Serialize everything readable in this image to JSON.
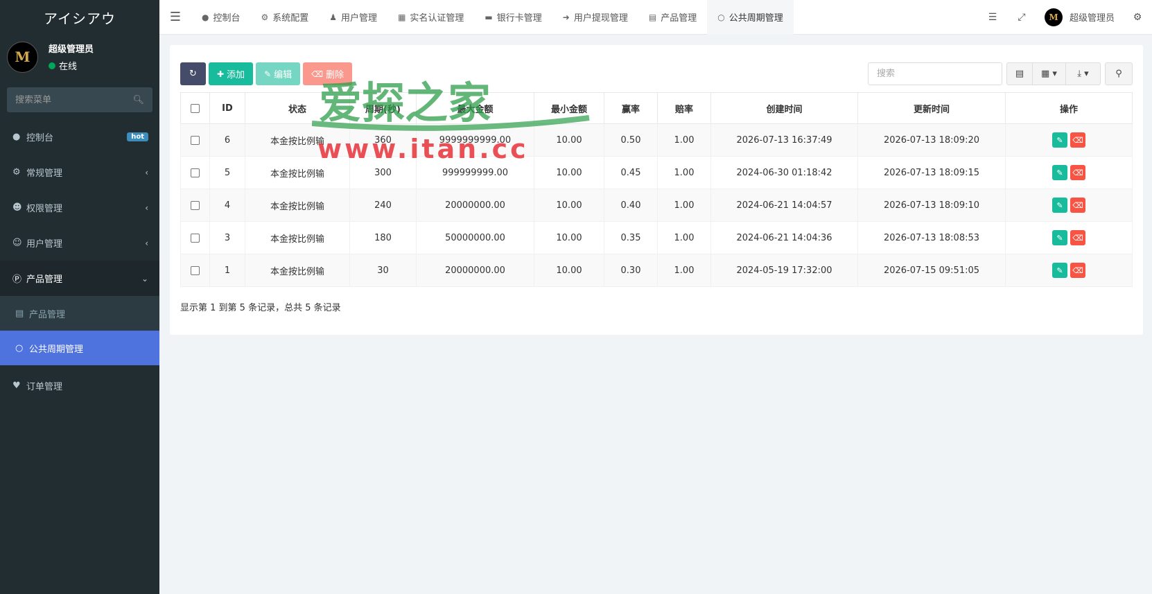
{
  "sidebar": {
    "brand": "アイシアウ",
    "user": {
      "avatar_letter": "M",
      "name": "超级管理员",
      "status": "在线"
    },
    "search_placeholder": "搜索菜单",
    "items": [
      {
        "label": "控制台",
        "icon": "dashboard-icon",
        "badge": "hot"
      },
      {
        "label": "常规管理",
        "icon": "cogs-icon"
      },
      {
        "label": "权限管理",
        "icon": "users-icon"
      },
      {
        "label": "用户管理",
        "icon": "user-circle-icon"
      },
      {
        "label": "产品管理",
        "icon": "product-p-icon"
      }
    ],
    "sub_items": [
      {
        "label": "产品管理",
        "icon": "shopping-bag-icon"
      },
      {
        "label": "公共周期管理",
        "icon": "circle-icon"
      }
    ],
    "after_items": [
      {
        "label": "订单管理",
        "icon": "heartbeat-icon"
      }
    ]
  },
  "topbar": {
    "tabs": [
      {
        "label": "控制台",
        "icon": "dashboard-icon"
      },
      {
        "label": "系统配置",
        "icon": "gear-icon"
      },
      {
        "label": "用户管理",
        "icon": "user-icon"
      },
      {
        "label": "实名认证管理",
        "icon": "id-card-icon"
      },
      {
        "label": "银行卡管理",
        "icon": "credit-card-icon"
      },
      {
        "label": "用户提现管理",
        "icon": "sign-out-icon"
      },
      {
        "label": "产品管理",
        "icon": "shopping-bag-icon"
      },
      {
        "label": "公共周期管理",
        "icon": "circle-icon"
      }
    ],
    "user_name": "超级管理员",
    "avatar_letter": "M"
  },
  "toolbar": {
    "add_label": "添加",
    "edit_label": "编辑",
    "delete_label": "删除",
    "search_placeholder": "搜索"
  },
  "table": {
    "headers": [
      "ID",
      "状态",
      "周期(秒)",
      "最大金额",
      "最小金额",
      "赢率",
      "赔率",
      "创建时间",
      "更新时间",
      "操作"
    ],
    "rows": [
      [
        "6",
        "本金按比例输",
        "360",
        "9999999999.00",
        "10.00",
        "0.50",
        "1.00",
        "2026-07-13 16:37:49",
        "2026-07-13 18:09:20"
      ],
      [
        "5",
        "本金按比例输",
        "300",
        "999999999.00",
        "10.00",
        "0.45",
        "1.00",
        "2024-06-30 01:18:42",
        "2026-07-13 18:09:15"
      ],
      [
        "4",
        "本金按比例输",
        "240",
        "20000000.00",
        "10.00",
        "0.40",
        "1.00",
        "2024-06-21 14:04:57",
        "2026-07-13 18:09:10"
      ],
      [
        "3",
        "本金按比例输",
        "180",
        "50000000.00",
        "10.00",
        "0.35",
        "1.00",
        "2024-06-21 14:04:36",
        "2026-07-13 18:08:53"
      ],
      [
        "1",
        "本金按比例输",
        "30",
        "20000000.00",
        "10.00",
        "0.30",
        "1.00",
        "2024-05-19 17:32:00",
        "2026-07-15 09:51:05"
      ]
    ]
  },
  "pagination": {
    "info": "显示第 1 到第 5 条记录，总共 5 条记录"
  },
  "watermark": {
    "line1": "爱探之家",
    "line2": "www.itan.cc"
  },
  "colors": {
    "sidebar_bg": "#222d32",
    "active_menu": "#4e73df",
    "success": "#18bc9c",
    "danger": "#f75444",
    "refresh": "#444c69"
  }
}
